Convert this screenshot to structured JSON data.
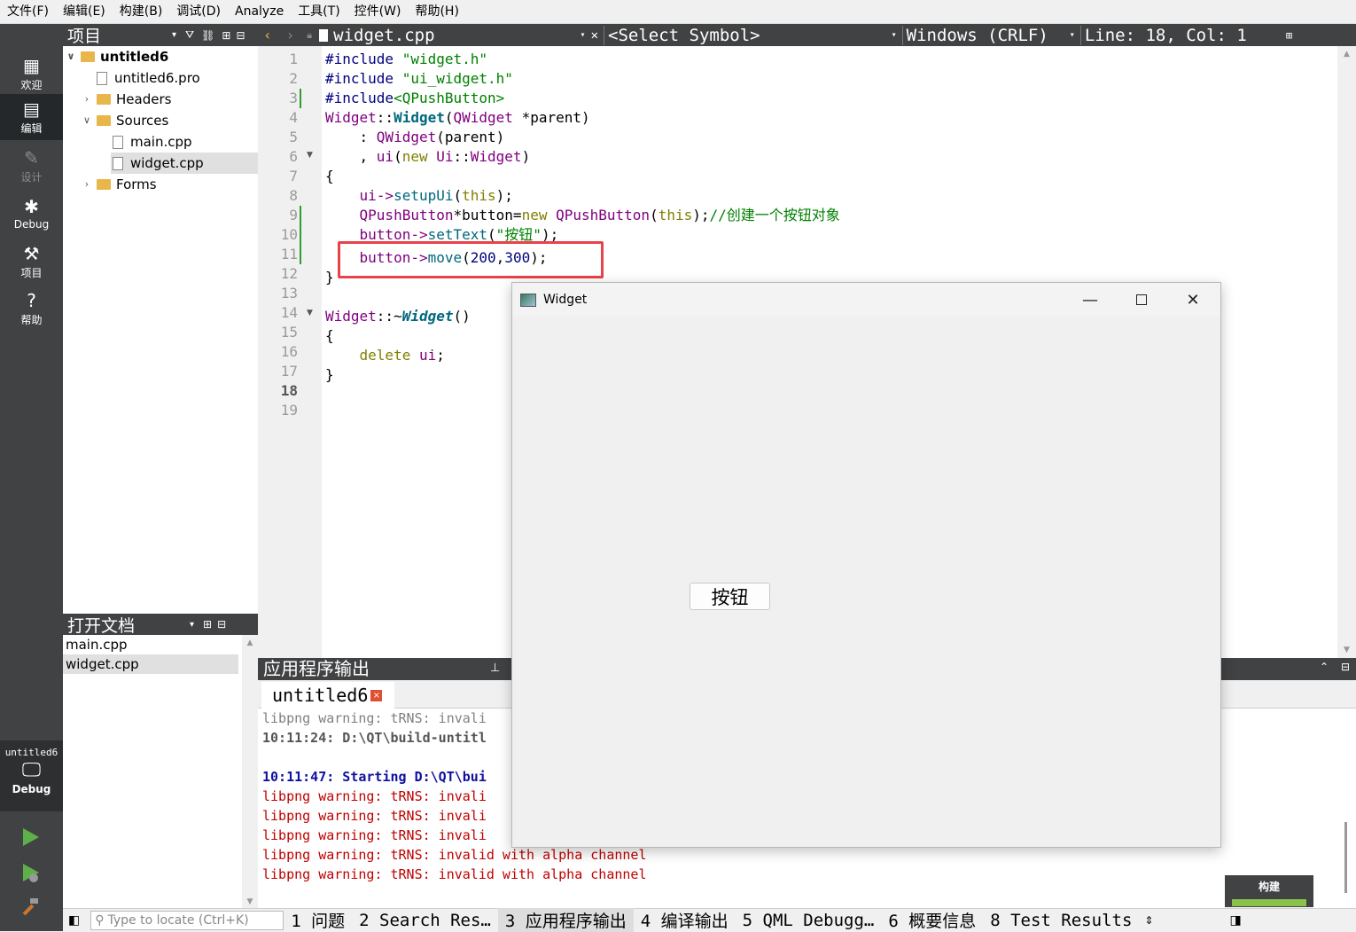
{
  "menu": [
    "文件(F)",
    "编辑(E)",
    "构建(B)",
    "调试(D)",
    "Analyze",
    "工具(T)",
    "控件(W)",
    "帮助(H)"
  ],
  "modes": [
    {
      "label": "欢迎",
      "icon": "grid-icon"
    },
    {
      "label": "编辑",
      "icon": "edit-icon"
    },
    {
      "label": "设计",
      "icon": "pencil-icon"
    },
    {
      "label": "Debug",
      "icon": "bug-icon"
    },
    {
      "label": "项目",
      "icon": "wrench-icon"
    },
    {
      "label": "帮助",
      "icon": "help-icon"
    }
  ],
  "kit": {
    "project": "untitled6",
    "config": "Debug"
  },
  "project_panel": {
    "title": "项目",
    "tree": [
      {
        "label": "untitled6"
      },
      {
        "label": "untitled6.pro"
      },
      {
        "label": "Headers"
      },
      {
        "label": "Sources"
      },
      {
        "label": "main.cpp"
      },
      {
        "label": "widget.cpp"
      },
      {
        "label": "Forms"
      }
    ]
  },
  "open_docs": {
    "title": "打开文档",
    "items": [
      "main.cpp",
      "widget.cpp"
    ]
  },
  "editor": {
    "file": "widget.cpp",
    "symbol": "<Select Symbol>",
    "line_ending": "Windows (CRLF)",
    "position": "Line: 18, Col: 1",
    "line_numbers": [
      "1",
      "2",
      "3",
      "4",
      "5",
      "6",
      "7",
      "8",
      "9",
      "10",
      "11",
      "12",
      "13",
      "14",
      "15",
      "16",
      "17",
      "18",
      "19"
    ],
    "lines": {
      "l1a": "#include ",
      "l1b": "\"widget.h\"",
      "l2a": "#include ",
      "l2b": "\"ui_widget.h\"",
      "l3a": "#include",
      "l3b": "<QPushButton>",
      "l4a": "Widget",
      "l4b": "::",
      "l4c": "Widget",
      "l4d": "(",
      "l4e": "QWidget",
      " l4f": " *parent)",
      "l4f": " *parent)",
      "l5a": "    : ",
      "l5b": "QWidget",
      "l5c": "(parent)",
      "l6a": "    , ",
      "l6b": "ui",
      "l6c": "(",
      "l6d": "new ",
      "l6e": "Ui",
      "l6f": "::",
      "l6g": "Widget",
      ")": ")",
      "l6h": ")",
      "l7": "{",
      "l8a": "    ui->",
      "l8b": "setupUi",
      "l8c": "(",
      "l8d": "this",
      "l8e": ");",
      "l9a": "    QPushButton",
      "l9b": "*button=",
      "l9c": "new ",
      "l9d": "QPushButton",
      "l9e": "(",
      "l9f": "this",
      "l9g": ");",
      "l9h": "//创建一个按钮对象",
      "l10a": "    button->",
      "l10b": "setText",
      "l10c": "(",
      "l10d": "\"按钮\"",
      "l10e": ");",
      "l11a": "    button->",
      "l11b": "move",
      "l11c": "(",
      "l11d": "200",
      "l11e": ",",
      "l11f": "300",
      "l11g": ");",
      "l12": "}",
      "l14a": "Widget",
      "l14b": "::~",
      "l14c": "Widget",
      "l14d": "()",
      "l15": "{",
      "l16a": "    ",
      "l16b": "delete ",
      "l16c": "ui",
      ";": ";",
      "l16d": ";",
      "l17": "}"
    }
  },
  "output": {
    "title": "应用程序输出",
    "tab": "untitled6",
    "lines": [
      "libpng warning: tRNS: invali",
      "10:11:24: D:\\QT\\build-untitl",
      "",
      "10:11:47: Starting D:\\QT\\bui",
      "libpng warning: tRNS: invali",
      "libpng warning: tRNS: invali",
      "libpng warning: tRNS: invali",
      "libpng warning: tRNS: invalid with alpha channel",
      "libpng warning: tRNS: invalid with alpha channel"
    ]
  },
  "app_window": {
    "title": "Widget",
    "button": "按钮"
  },
  "status": {
    "locate_placeholder": "Type to locate (Ctrl+K)",
    "tabs": [
      "1 问题",
      "2 Search Res…",
      "3 应用程序输出",
      "4 编译输出",
      "5 QML Debugg…",
      "6 概要信息",
      "8 Test Results"
    ]
  },
  "build_label": "构建",
  "colors": {
    "sidebar": "#404244",
    "highlight": "#e8434a",
    "keyword": "#808000",
    "string": "#008000",
    "type": "#800080"
  }
}
